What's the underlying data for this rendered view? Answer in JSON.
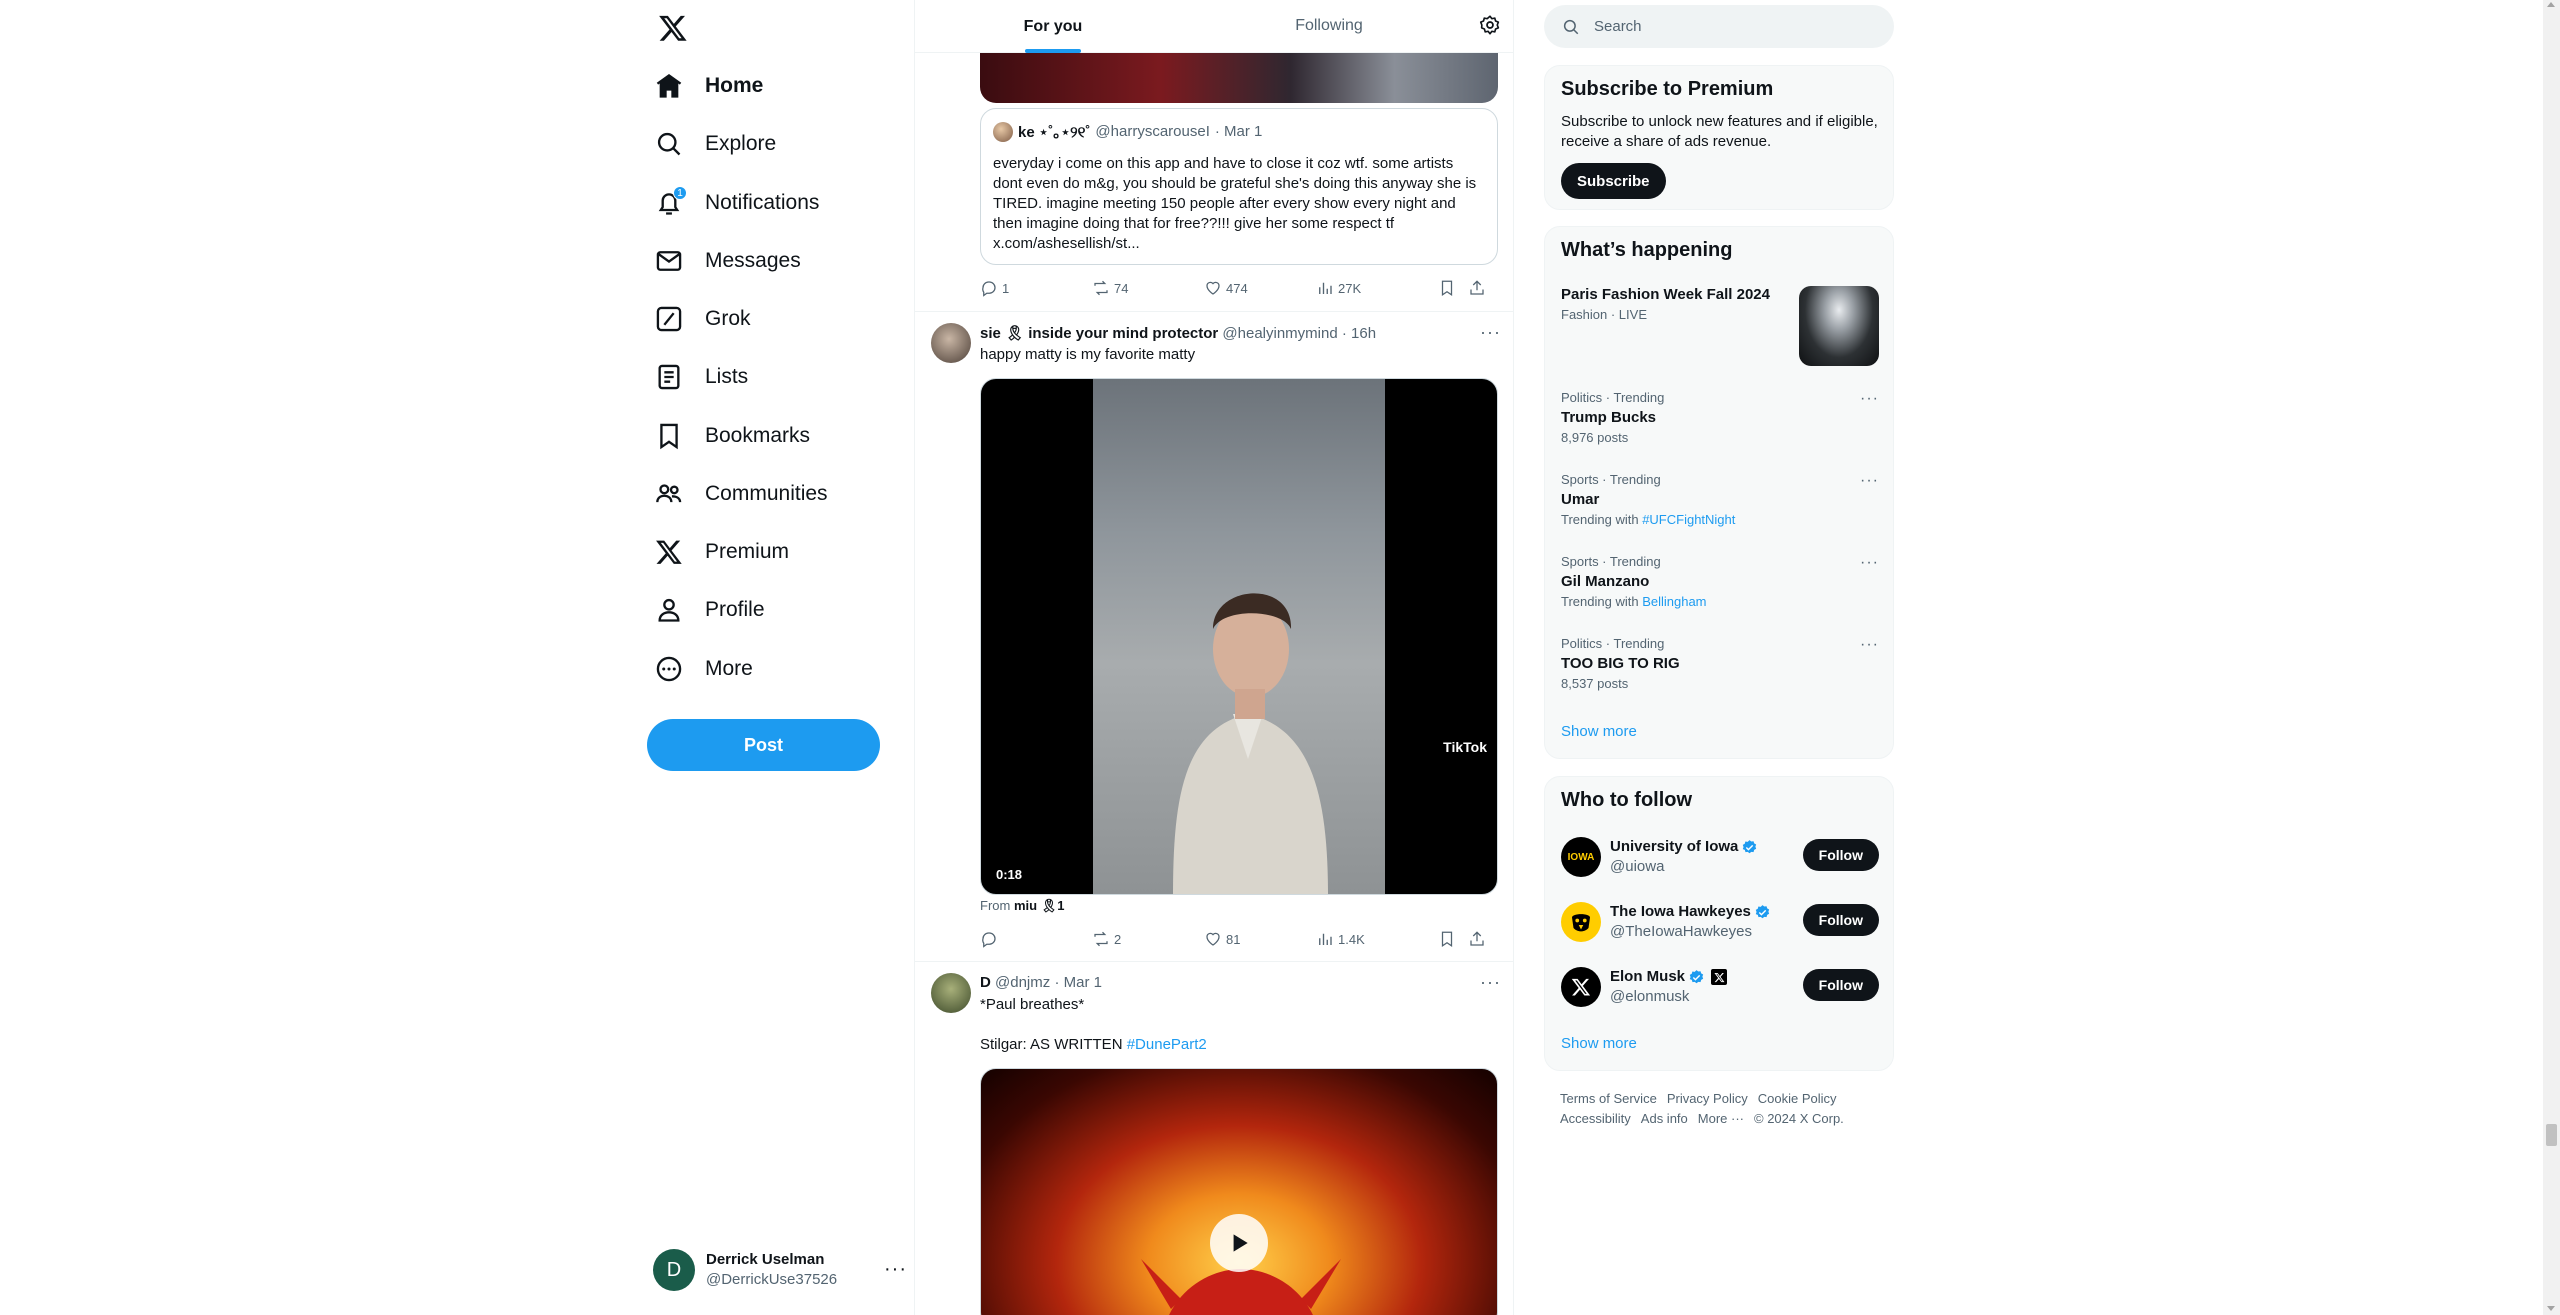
{
  "nav": {
    "items": [
      {
        "label": "Home",
        "icon": "home-icon"
      },
      {
        "label": "Explore",
        "icon": "search-icon"
      },
      {
        "label": "Notifications",
        "icon": "bell-icon",
        "badge": "1"
      },
      {
        "label": "Messages",
        "icon": "envelope-icon"
      },
      {
        "label": "Grok",
        "icon": "grok-icon"
      },
      {
        "label": "Lists",
        "icon": "list-icon"
      },
      {
        "label": "Bookmarks",
        "icon": "bookmark-icon"
      },
      {
        "label": "Communities",
        "icon": "people-icon"
      },
      {
        "label": "Premium",
        "icon": "x-icon"
      },
      {
        "label": "Profile",
        "icon": "person-icon"
      },
      {
        "label": "More",
        "icon": "more-circle-icon"
      }
    ],
    "post_label": "Post",
    "account": {
      "initial": "D",
      "name": "Derrick Uselman",
      "handle": "@DerrickUse37526"
    }
  },
  "timeline": {
    "tabs": [
      {
        "label": "For you",
        "active": true
      },
      {
        "label": "Following",
        "active": false
      }
    ],
    "quote": {
      "name": "ke ⋆˚｡⋆୨୧˚",
      "handle": "@harryscarouseI",
      "date": "· Mar 1",
      "text": "everyday i come on this app and have to close it coz wtf. some artists dont even do m&g, you should be grateful she's doing this anyway she is TIRED. imagine meeting 150 people after every show every night and then imagine doing that for free??!!! give her some respect tf x.com/ashesellish/st..."
    },
    "tweet1_actions": {
      "replies": "1",
      "reposts": "74",
      "likes": "474",
      "views": "27K"
    },
    "tweet2": {
      "name": "sie 🎗 inside your mind protector",
      "handle": "@healyinmymind",
      "time": "· 16h",
      "text": "happy matty is my favorite matty",
      "video_duration": "0:18",
      "watermark": "TikTok",
      "from_label": "From",
      "from_source": "miu 🎗1",
      "actions": {
        "replies": "",
        "reposts": "2",
        "likes": "81",
        "views": "1.4K"
      }
    },
    "tweet3": {
      "name": "D",
      "handle": "@dnjmz",
      "time": "· Mar 1",
      "line1": "*Paul breathes*",
      "line2": "Stilgar: AS WRITTEN",
      "hashtag": "#DunePart2"
    }
  },
  "sidebar": {
    "search_placeholder": "Search",
    "premium": {
      "title": "Subscribe to Premium",
      "desc": "Subscribe to unlock new features and if eligible, receive a share of ads revenue.",
      "button": "Subscribe"
    },
    "happening": {
      "title": "What’s happening",
      "featured": {
        "title": "Paris Fashion Week Fall 2024",
        "meta": "Fashion · LIVE"
      },
      "trends": [
        {
          "category": "Politics · Trending",
          "title": "Trump Bucks",
          "sub_prefix": "",
          "sub_link": "",
          "sub": "8,976 posts"
        },
        {
          "category": "Sports · Trending",
          "title": "Umar",
          "sub_prefix": "Trending with",
          "sub_link": "#UFCFightNight",
          "sub": ""
        },
        {
          "category": "Sports · Trending",
          "title": "Gil Manzano",
          "sub_prefix": "Trending with",
          "sub_link": "Bellingham",
          "sub": ""
        },
        {
          "category": "Politics · Trending",
          "title": "TOO BIG TO RIG",
          "sub_prefix": "",
          "sub_link": "",
          "sub": "8,537 posts"
        }
      ],
      "show_more": "Show more"
    },
    "who_to_follow": {
      "title": "Who to follow",
      "accounts": [
        {
          "name": "University of Iowa",
          "handle": "@uiowa",
          "avatar_text": "IOWA",
          "button": "Follow"
        },
        {
          "name": "The Iowa Hawkeyes",
          "handle": "@TheIowaHawkeyes",
          "avatar_text": "",
          "button": "Follow"
        },
        {
          "name": "Elon Musk",
          "handle": "@elonmusk",
          "avatar_text": "",
          "button": "Follow"
        }
      ],
      "show_more": "Show more"
    },
    "footer": [
      "Terms of Service",
      "Privacy Policy",
      "Cookie Policy",
      "Accessibility",
      "Ads info",
      "More ···",
      "© 2024 X Corp."
    ]
  },
  "colors": {
    "accent": "#1d9bf0",
    "text": "#0f1419",
    "muted": "#536471",
    "border": "#eff3f4"
  }
}
